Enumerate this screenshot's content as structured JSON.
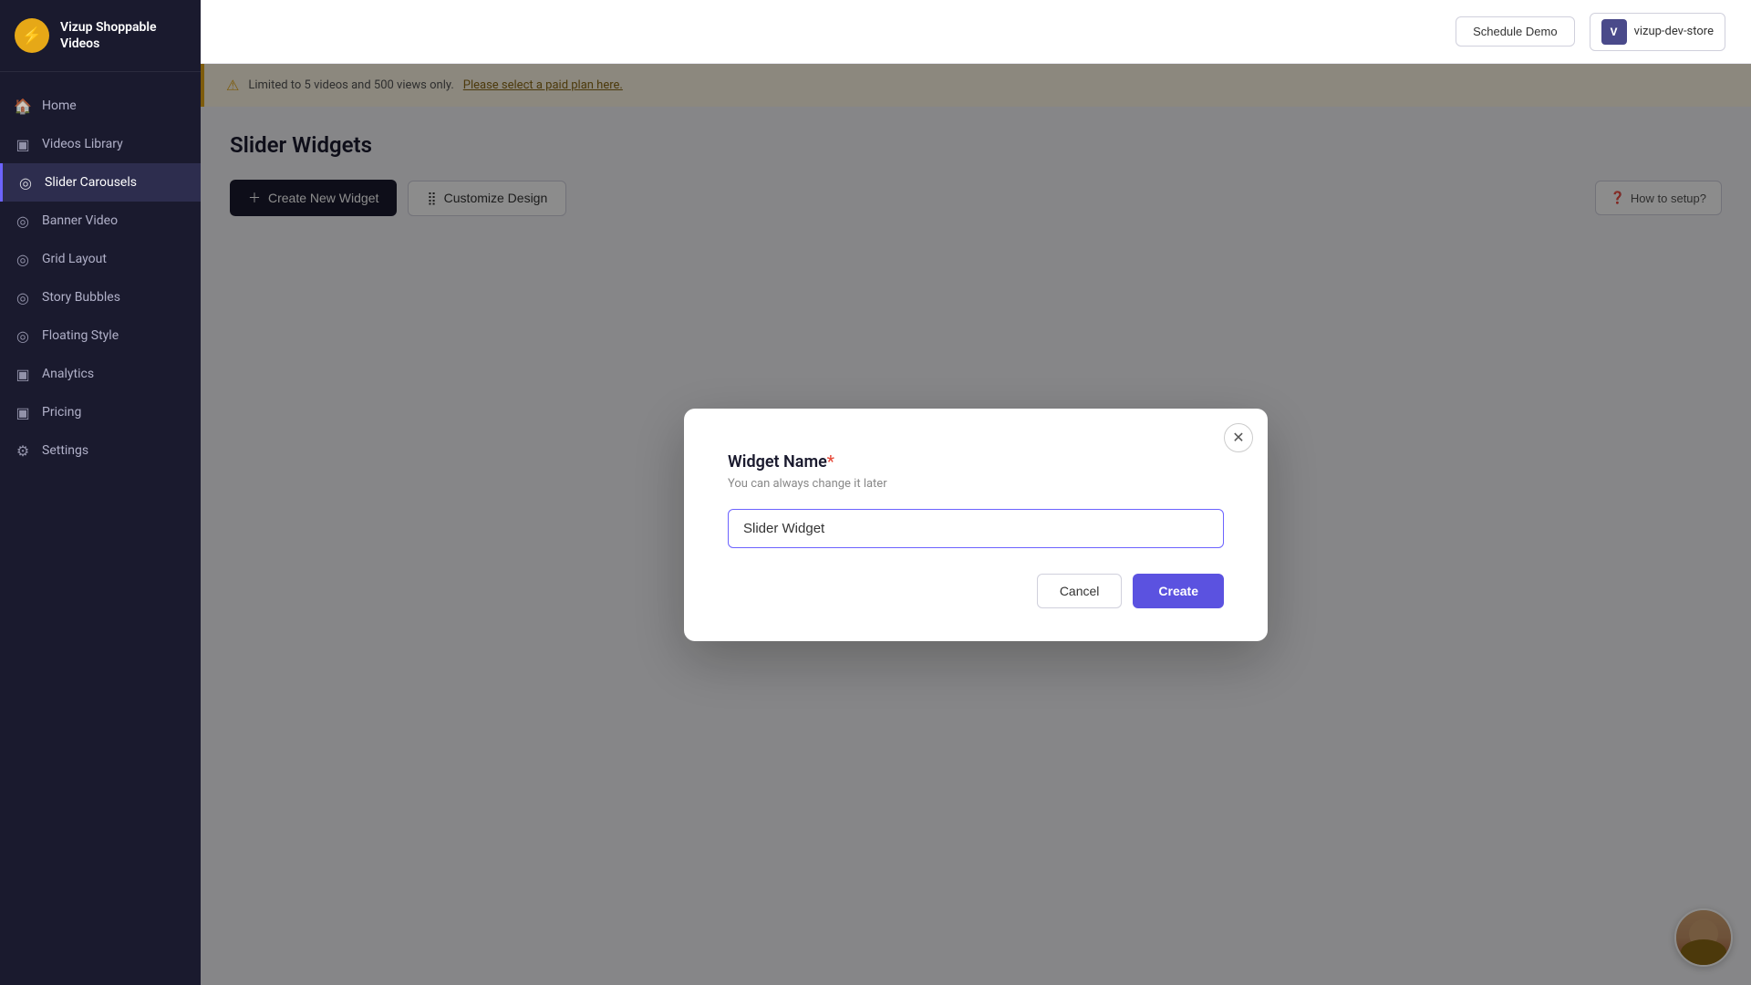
{
  "app": {
    "logo_letter": "⚡",
    "logo_text_line1": "Vizup Shoppable",
    "logo_text_line2": "Videos"
  },
  "header": {
    "schedule_demo_label": "Schedule Demo",
    "user_initial": "V",
    "user_store": "vizup-dev-store"
  },
  "banner": {
    "text": "Limited to 5 videos and 500 views only.",
    "link_text": "Please select a paid plan here."
  },
  "sidebar": {
    "items": [
      {
        "id": "home",
        "label": "Home",
        "icon": "🏠"
      },
      {
        "id": "videos-library",
        "label": "Videos Library",
        "icon": "⊞"
      },
      {
        "id": "slider-carousels",
        "label": "Slider Carousels",
        "icon": "◎",
        "active": true
      },
      {
        "id": "banner-video",
        "label": "Banner Video",
        "icon": "◎"
      },
      {
        "id": "grid-layout",
        "label": "Grid Layout",
        "icon": "◎"
      },
      {
        "id": "story-bubbles",
        "label": "Story Bubbles",
        "icon": "◎"
      },
      {
        "id": "floating-style",
        "label": "Floating Style",
        "icon": "◎"
      },
      {
        "id": "analytics",
        "label": "Analytics",
        "icon": "⊞"
      },
      {
        "id": "pricing",
        "label": "Pricing",
        "icon": "⊞"
      },
      {
        "id": "settings",
        "label": "Settings",
        "icon": "⚙"
      }
    ]
  },
  "page": {
    "title": "Slider Widgets",
    "create_button_label": "Create New Widget",
    "customize_button_label": "Customize Design",
    "how_to_label": "How to setup?"
  },
  "modal": {
    "title": "Widget Name",
    "required_marker": "*",
    "hint": "You can always change it later",
    "input_value": "Slider Widget",
    "cancel_label": "Cancel",
    "create_label": "Create"
  }
}
